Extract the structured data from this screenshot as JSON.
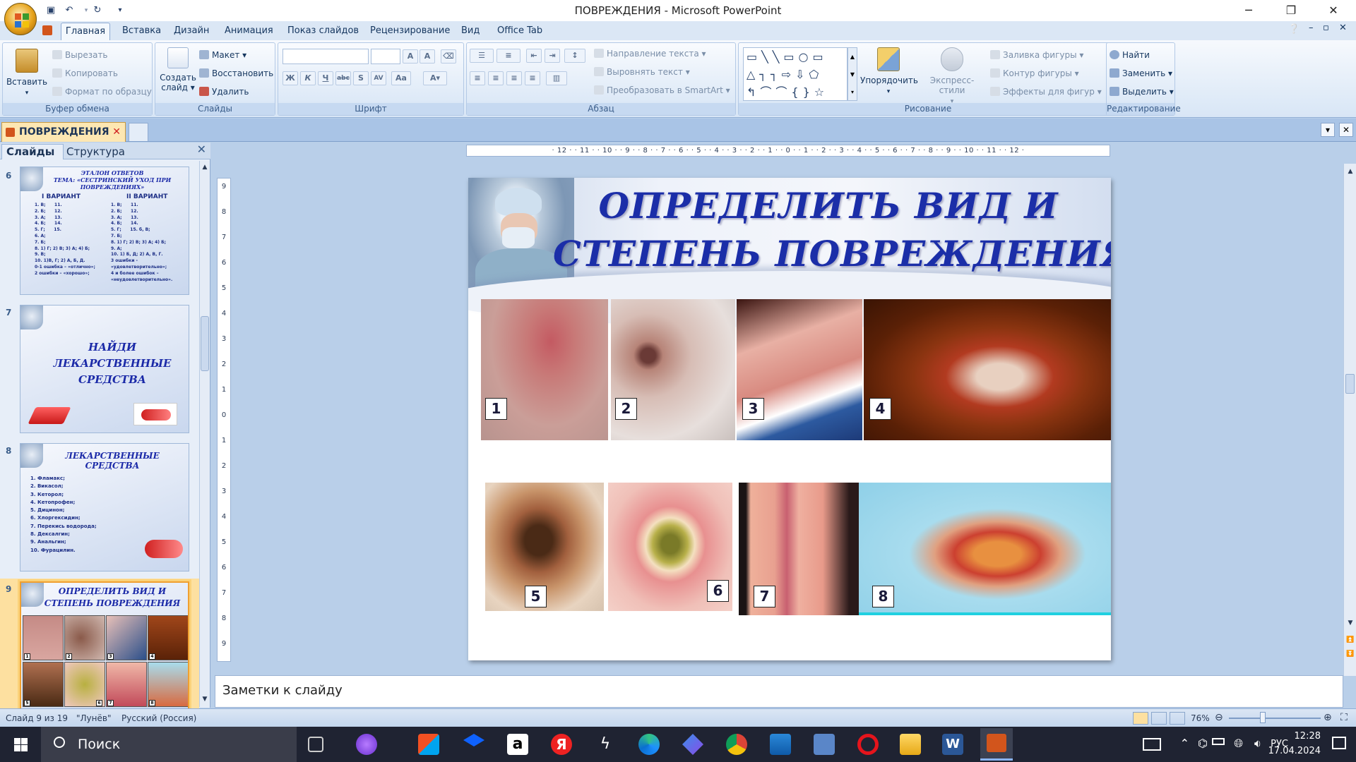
{
  "window": {
    "title": "ПОВРЕЖДЕНИЯ - Microsoft PowerPoint"
  },
  "ribbon_tabs": [
    "Главная",
    "Вставка",
    "Дизайн",
    "Анимация",
    "Показ слайдов",
    "Рецензирование",
    "Вид",
    "Office Tab"
  ],
  "clipboard": {
    "paste": "Вставить",
    "cut": "Вырезать",
    "copy": "Копировать",
    "format_painter": "Формат по образцу",
    "group": "Буфер обмена"
  },
  "slides_group": {
    "new_slide_1": "Создать",
    "new_slide_2": "слайд",
    "layout": "Макет",
    "reset": "Восстановить",
    "delete": "Удалить",
    "group": "Слайды"
  },
  "font_group": {
    "group": "Шрифт"
  },
  "paragraph_group": {
    "text_direction": "Направление текста",
    "align_text": "Выровнять текст",
    "smartart": "Преобразовать в SmartArt",
    "group": "Абзац"
  },
  "drawing_group": {
    "arrange": "Упорядочить",
    "quick_styles": "Экспресс-стили",
    "fill": "Заливка фигуры",
    "outline": "Контур фигуры",
    "effects": "Эффекты для фигур",
    "group": "Рисование"
  },
  "editing_group": {
    "find": "Найти",
    "replace": "Заменить",
    "select": "Выделить",
    "group": "Редактирование"
  },
  "doc_tab": "ПОВРЕЖДЕНИЯ",
  "panel_tabs": {
    "slides": "Слайды",
    "outline": "Структура"
  },
  "thumbnails": [
    {
      "num": "6",
      "title": "ЭТАЛОН ОТВЕТОВ\nТЕМА: «СЕСТРИНСКИЙ УХОД ПРИ\nПОВРЕЖДЕНИЯХ»",
      "col1_head": "I ВАРИАНТ",
      "col2_head": "II ВАРИАНТ",
      "col1": "1. В;      11.\n2. Б;      12.\n3. А;      13.\n4. Б;      14.\n5. Г;      15.\n6. А;\n7. Б;\n8. 1) Г; 2) В; 3) А; 4) Б;\n9. В;\n10. 1)В, Г; 2) А, Б, Д.\n0-1 ошибка – «отлично»;\n2 ошибки – «хорошо»;",
      "col2": "1. В;      11.\n2. Б;      12.\n3. А;      13.\n4. Б;      14.\n5. Г;      15. б, В;\n7. Б;\n8. 1) Г; 2) В; 3) А; 4) Б;\n9. А;\n10. 1) Б, Д; 2) А, В, Г.\n3 ошибки -\n«удовлетворительно»;\n4 и более ошибок –\n«неудовлетворительно»."
    },
    {
      "num": "7",
      "title": "НАЙДИ\nЛЕКАРСТВЕННЫЕ\nСРЕДСТВА"
    },
    {
      "num": "8",
      "title": "ЛЕКАРСТВЕННЫЕ СРЕДСТВА",
      "list": "1. Фламакс;\n2. Викасол;\n3. Кеторол;\n4. Кетопрофен;\n5. Дицинон;\n6. Хлоргексидин;\n7. Перекись водорода;\n8. Дексалгин;\n9. Анальгин;\n10. Фурацилин."
    },
    {
      "num": "9",
      "title": "ОПРЕДЕЛИТЬ ВИД И\nСТЕПЕНЬ ПОВРЕЖДЕНИЯ",
      "mini_labels": [
        "1",
        "2",
        "3",
        "4",
        "5",
        "6",
        "7",
        "8"
      ]
    }
  ],
  "ruler": {
    "h": "· 12 · · 11 · · 10 · · 9 · · 8 · · 7 · · 6 · · 5 · · 4 · · 3 · · 2 · · 1 · · 0 · · 1 · · 2 · · 3 · · 4 · · 5 · · 6 · · 7 · · 8 · · 9 · · 10 · · 11 · · 12 ·",
    "v": [
      "9",
      "8",
      "7",
      "6",
      "5",
      "4",
      "3",
      "2",
      "1",
      "0",
      "1",
      "2",
      "3",
      "4",
      "5",
      "6",
      "7",
      "8",
      "9"
    ]
  },
  "slide": {
    "title": "ОПРЕДЕЛИТЬ ВИД И\nСТЕПЕНЬ ПОВРЕЖДЕНИЯ",
    "images": [
      {
        "label": "1",
        "desc": "redness-skin-photo"
      },
      {
        "label": "2",
        "desc": "knee-wound-photo"
      },
      {
        "label": "3",
        "desc": "hands-burn-photo"
      },
      {
        "label": "4",
        "desc": "hands-frostbite-photo"
      },
      {
        "label": "5",
        "desc": "charred-hand-photo"
      },
      {
        "label": "6",
        "desc": "ulcer-photo"
      },
      {
        "label": "7",
        "desc": "fingers-redness-photo"
      },
      {
        "label": "8",
        "desc": "child-hand-blisters-photo"
      }
    ]
  },
  "notes_placeholder": "Заметки к слайду",
  "status": {
    "slide": "Слайд 9 из 19",
    "theme": "\"Лунёв\"",
    "lang": "Русский (Россия)",
    "zoom": "76%"
  },
  "taskbar": {
    "search": "Поиск",
    "lang": "РУС",
    "time": "12:28",
    "date": "17.04.2024"
  },
  "colors": {
    "title_blue": "#1b2ea8",
    "ribbon_blue": "#dbe7f5",
    "selected_thumb": "#f0a030"
  }
}
